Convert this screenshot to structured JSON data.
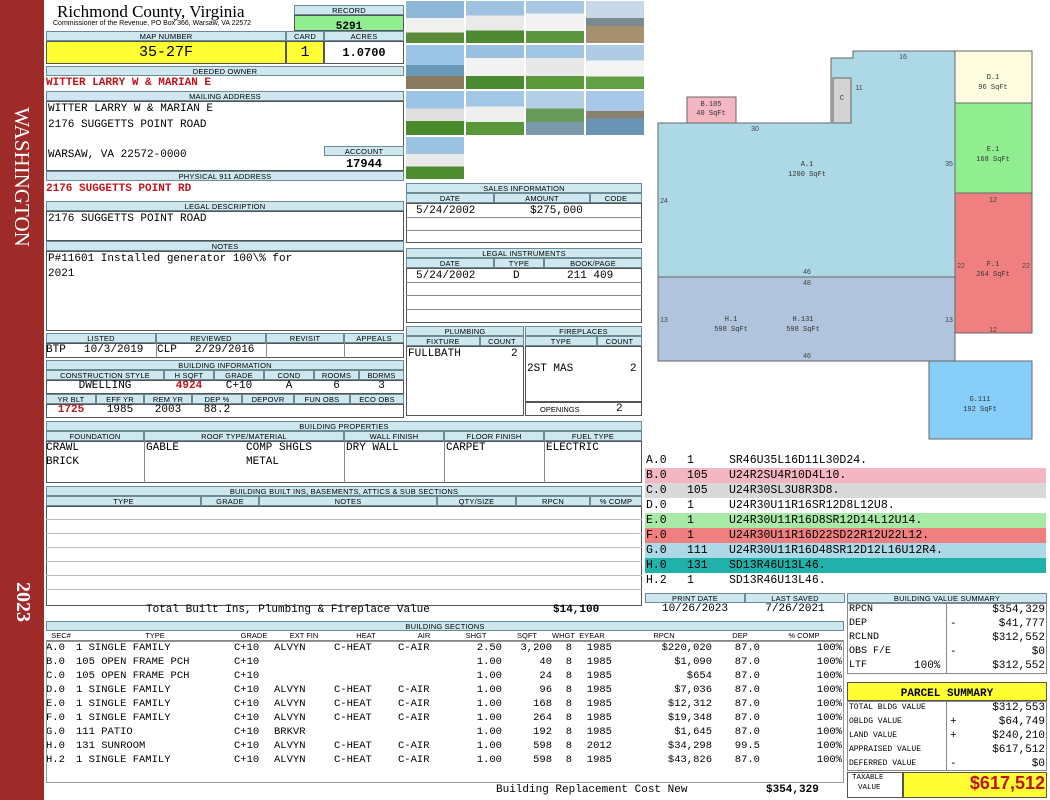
{
  "sidebar": {
    "district": "WASHINGTON",
    "year": "2023"
  },
  "header": {
    "county": "Richmond County, Virginia",
    "subtitle": "Commissioner of the Revenue, PO Box 366, Warsaw, VA 22572",
    "record_label": "RECORD",
    "record": "5291",
    "map_label": "MAP NUMBER",
    "map": "35-27F",
    "card_label": "CARD",
    "card": "1",
    "acres_label": "ACRES",
    "acres": "1.0700"
  },
  "owner": {
    "deeded_label": "DEEDED OWNER",
    "deeded": "WITTER LARRY W & MARIAN E",
    "mailing_label": "MAILING ADDRESS",
    "mail1": "WITTER LARRY W & MARIAN E",
    "mail2": "2176 SUGGETTS POINT ROAD",
    "mail3": "WARSAW, VA 22572-0000",
    "account_label": "ACCOUNT",
    "account": "17944",
    "physical_label": "PHYSICAL 911 ADDRESS",
    "physical": "2176 SUGGETTS POINT RD",
    "legal_label": "LEGAL DESCRIPTION",
    "legal": "2176 SUGGETTS POINT ROAD",
    "notes_label": "NOTES",
    "notes1": "P#11601 Installed generator 100\\% for",
    "notes2": "2021"
  },
  "sales": {
    "title": "SALES INFORMATION",
    "h_date": "DATE",
    "h_amount": "AMOUNT",
    "h_code": "CODE",
    "date": "5/24/2002",
    "amount": "$275,000",
    "code": ""
  },
  "legal_inst": {
    "title": "LEGAL INSTRUMENTS",
    "h_date": "DATE",
    "h_type": "TYPE",
    "h_book": "BOOK/PAGE",
    "date": "5/24/2002",
    "type": "D",
    "book": "211 409"
  },
  "review": {
    "listed_label": "LISTED",
    "listed_by": "BTP",
    "listed_date": "10/3/2019",
    "reviewed_label": "REVIEWED",
    "reviewed_by": "CLP",
    "reviewed_date": "2/29/2016",
    "revisit_label": "REVISIT",
    "appeals_label": "APPEALS"
  },
  "building_info": {
    "title": "BUILDING INFORMATION",
    "h_style": "CONSTRUCTION STYLE",
    "h_hsqft": "H SQFT",
    "h_grade": "GRADE",
    "h_cond": "COND",
    "h_rooms": "ROOMS",
    "h_bdrms": "BDRMS",
    "style": "DWELLING",
    "hsqft": "4924",
    "grade": "C+10",
    "cond": "A",
    "rooms": "6",
    "bdrms": "3",
    "h_yrblt": "YR BLT",
    "h_effyr": "EFF YR",
    "h_remyr": "REM YR",
    "h_dep": "DEP %",
    "h_depovr": "DEPOVR",
    "h_funobs": "FUN OBS",
    "h_ecoobs": "ECO OBS",
    "yrblt": "1725",
    "effyr": "1985",
    "remyr": "2003",
    "dep": "88.2"
  },
  "plumbing": {
    "title": "PLUMBING",
    "h_fixture": "FIXTURE",
    "h_count": "COUNT",
    "fixture": "FULLBATH",
    "count": "2"
  },
  "fireplaces": {
    "title": "FIREPLACES",
    "h_type": "TYPE",
    "h_count": "COUNT",
    "type": "2ST MAS",
    "count": "2",
    "openings_label": "OPENINGS",
    "openings": "2"
  },
  "properties": {
    "title": "BUILDING PROPERTIES",
    "h_foundation": "FOUNDATION",
    "h_roof": "ROOF TYPE/MATERIAL",
    "h_wall": "WALL FINISH",
    "h_floor": "FLOOR FINISH",
    "h_fuel": "FUEL TYPE",
    "foundation1": "CRAWL",
    "foundation2": "BRICK",
    "roof_type": "GABLE",
    "roof_mat1": "COMP SHGLS",
    "roof_mat2": "METAL",
    "wall": "DRY WALL",
    "floor": "CARPET",
    "fuel": "ELECTRIC"
  },
  "builtins": {
    "title": "BUILDING BUILT INS, BASEMENTS, ATTICS & SUB SECTIONS",
    "h_type": "TYPE",
    "h_grade": "GRADE",
    "h_notes": "NOTES",
    "h_qty": "QTY/SIZE",
    "h_rpcn": "RPCN",
    "h_comp": "% COMP",
    "total_label": "Total Built Ins, Plumbing & Fireplace Value",
    "total": "$14,100"
  },
  "dates": {
    "print_label": "PRINT DATE",
    "print": "10/26/2023",
    "saved_label": "LAST SAVED",
    "saved": "7/26/2021"
  },
  "sections": {
    "title": "BUILDING SECTIONS",
    "headers": [
      "SEC#",
      "TYPE",
      "GRADE",
      "EXT FIN",
      "HEAT",
      "AIR",
      "SHGT",
      "SQFT",
      "WHGT",
      "EYEAR",
      "RPCN",
      "DEP",
      "% COMP"
    ],
    "rows": [
      [
        "A.0",
        "1 SINGLE FAMILY",
        "C+10",
        "ALVYN",
        "C-HEAT",
        "C-AIR",
        "2.50",
        "3,200",
        "8",
        "1985",
        "$220,020",
        "87.0",
        "100%"
      ],
      [
        "B.0",
        "105 OPEN FRAME PCH",
        "C+10",
        "",
        "",
        "",
        "1.00",
        "40",
        "8",
        "1985",
        "$1,090",
        "87.0",
        "100%"
      ],
      [
        "C.0",
        "105 OPEN FRAME PCH",
        "C+10",
        "",
        "",
        "",
        "1.00",
        "24",
        "8",
        "1985",
        "$654",
        "87.0",
        "100%"
      ],
      [
        "D.0",
        "1 SINGLE FAMILY",
        "C+10",
        "ALVYN",
        "C-HEAT",
        "C-AIR",
        "1.00",
        "96",
        "8",
        "1985",
        "$7,036",
        "87.0",
        "100%"
      ],
      [
        "E.0",
        "1 SINGLE FAMILY",
        "C+10",
        "ALVYN",
        "C-HEAT",
        "C-AIR",
        "1.00",
        "168",
        "8",
        "1985",
        "$12,312",
        "87.0",
        "100%"
      ],
      [
        "F.0",
        "1 SINGLE FAMILY",
        "C+10",
        "ALVYN",
        "C-HEAT",
        "C-AIR",
        "1.00",
        "264",
        "8",
        "1985",
        "$19,348",
        "87.0",
        "100%"
      ],
      [
        "G.0",
        "111 PATIO",
        "C+10",
        "BRKVR",
        "",
        "",
        "1.00",
        "192",
        "8",
        "1985",
        "$1,645",
        "87.0",
        "100%"
      ],
      [
        "H.0",
        "131 SUNROOM",
        "C+10",
        "ALVYN",
        "C-HEAT",
        "C-AIR",
        "1.00",
        "598",
        "8",
        "2012",
        "$34,298",
        "99.5",
        "100%"
      ],
      [
        "H.2",
        "1 SINGLE FAMILY",
        "C+10",
        "ALVYN",
        "C-HEAT",
        "C-AIR",
        "1.00",
        "598",
        "8",
        "1985",
        "$43,826",
        "87.0",
        "100%"
      ]
    ],
    "replacement_label": "Building Replacement Cost New",
    "replacement": "$354,329"
  },
  "sketch": {
    "labels": {
      "b_name": "B.105",
      "b_area": "40 SqFt",
      "c_name": "C",
      "d_name": "D.1",
      "d_area": "96 SqFt",
      "e_name": "E.1",
      "e_area": "168 SqFt",
      "a_name": "A.1",
      "a_area": "1200 SqFt",
      "f_name": "F.1",
      "f_area": "264 SqFt",
      "h1_name": "H.1",
      "h1_area": "598 SqFt",
      "h2_name": "H.131",
      "h2_area": "598 SqFt",
      "g_name": "G.111",
      "g_area": "192 SqFt"
    },
    "dims": {
      "d16": "16",
      "d11": "11",
      "d30": "30",
      "d24": "24",
      "d35": "35",
      "d12a": "12",
      "d22a": "22",
      "d22b": "22",
      "d46a": "46",
      "d48": "48",
      "d13a": "13",
      "d13b": "13",
      "d12b": "12",
      "d46b": "46"
    },
    "colors": {
      "a": "#add8e6",
      "b": "#f4b6c2",
      "c": "#d3d3d3",
      "d": "#fffde0",
      "e": "#90ee90",
      "f": "#f08080",
      "g": "#87cefa",
      "h": "#b0c4de"
    }
  },
  "codes": [
    {
      "sec": "A.0",
      "n": "1",
      "code": "SR46U35L16D11L30D24.",
      "color": "#ffffff"
    },
    {
      "sec": "B.0",
      "n": "105",
      "code": "U24R2SU4R10D4L10.",
      "color": "#f4b6c2"
    },
    {
      "sec": "C.0",
      "n": "105",
      "code": "U24R30SL3U8R3D8.",
      "color": "#d9d9d9"
    },
    {
      "sec": "D.0",
      "n": "1",
      "code": "U24R30U11R16SR12D8L12U8.",
      "color": "#ffffff"
    },
    {
      "sec": "E.0",
      "n": "1",
      "code": "U24R30U11R16D8SR12D14L12U14.",
      "color": "#a6eaa6"
    },
    {
      "sec": "F.0",
      "n": "1",
      "code": "U24R30U11R16D22SD22R12U22L12.",
      "color": "#f08080"
    },
    {
      "sec": "G.0",
      "n": "111",
      "code": "U24R30U11R16D48SR12D12L16U12R4.",
      "color": "#add8e6"
    },
    {
      "sec": "H.0",
      "n": "131",
      "code": "SD13R46U13L46.",
      "color": "#20b2aa"
    },
    {
      "sec": "H.2",
      "n": "1",
      "code": "SD13R46U13L46.",
      "color": "#ffffff"
    }
  ],
  "value_summary": {
    "title": "BUILDING VALUE SUMMARY",
    "rpcn_label": "RPCN",
    "rpcn": "$354,329",
    "dep_label": "DEP",
    "dep_sign": "-",
    "dep": "$41,777",
    "rclnd_label": "RCLND",
    "rclnd": "$312,552",
    "obs_label": "OBS F/E",
    "obs_sign": "-",
    "obs": "$0",
    "ltf_label": "LTF",
    "ltf_pct": "100%",
    "ltf": "$312,552"
  },
  "parcel": {
    "title": "PARCEL SUMMARY",
    "bldg_label": "TOTAL BLDG VALUE",
    "bldg": "$312,553",
    "obldg_label": "OBLDG VALUE",
    "obldg_sign": "+",
    "obldg": "$64,749",
    "land_label": "LAND VALUE",
    "land_sign": "+",
    "land": "$240,210",
    "appraised_label": "APPRAISED VALUE",
    "appraised": "$617,512",
    "deferred_label": "DEFERRED VALUE",
    "deferred_sign": "-",
    "deferred": "$0",
    "taxable_label1": "TAXABLE",
    "taxable_label2": "VALUE",
    "taxable": "$617,512"
  }
}
